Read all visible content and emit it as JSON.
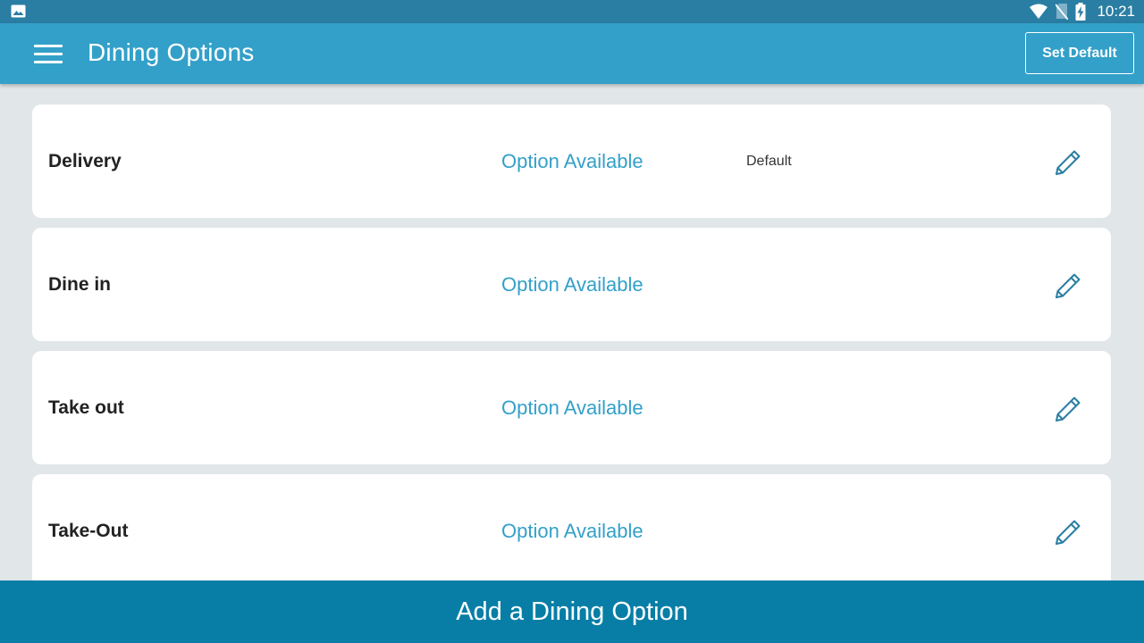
{
  "status_bar": {
    "time": "10:21",
    "icons": [
      "image-icon",
      "wifi-icon",
      "no-sim-icon",
      "battery-charging-icon"
    ]
  },
  "app_bar": {
    "title": "Dining Options",
    "set_default_label": "Set Default"
  },
  "dining_options": [
    {
      "name": "Delivery",
      "status": "Option Available",
      "badge": "Default"
    },
    {
      "name": "Dine in",
      "status": "Option Available",
      "badge": ""
    },
    {
      "name": "Take out",
      "status": "Option Available",
      "badge": ""
    },
    {
      "name": "Take-Out",
      "status": "Option Available",
      "badge": ""
    }
  ],
  "add_button_label": "Add a Dining Option",
  "colors": {
    "status_bar": "#2a7ea3",
    "app_bar": "#33a0c9",
    "accent": "#33a0c9",
    "bottom_bar": "#087ea6",
    "background": "#e1e6e9"
  }
}
